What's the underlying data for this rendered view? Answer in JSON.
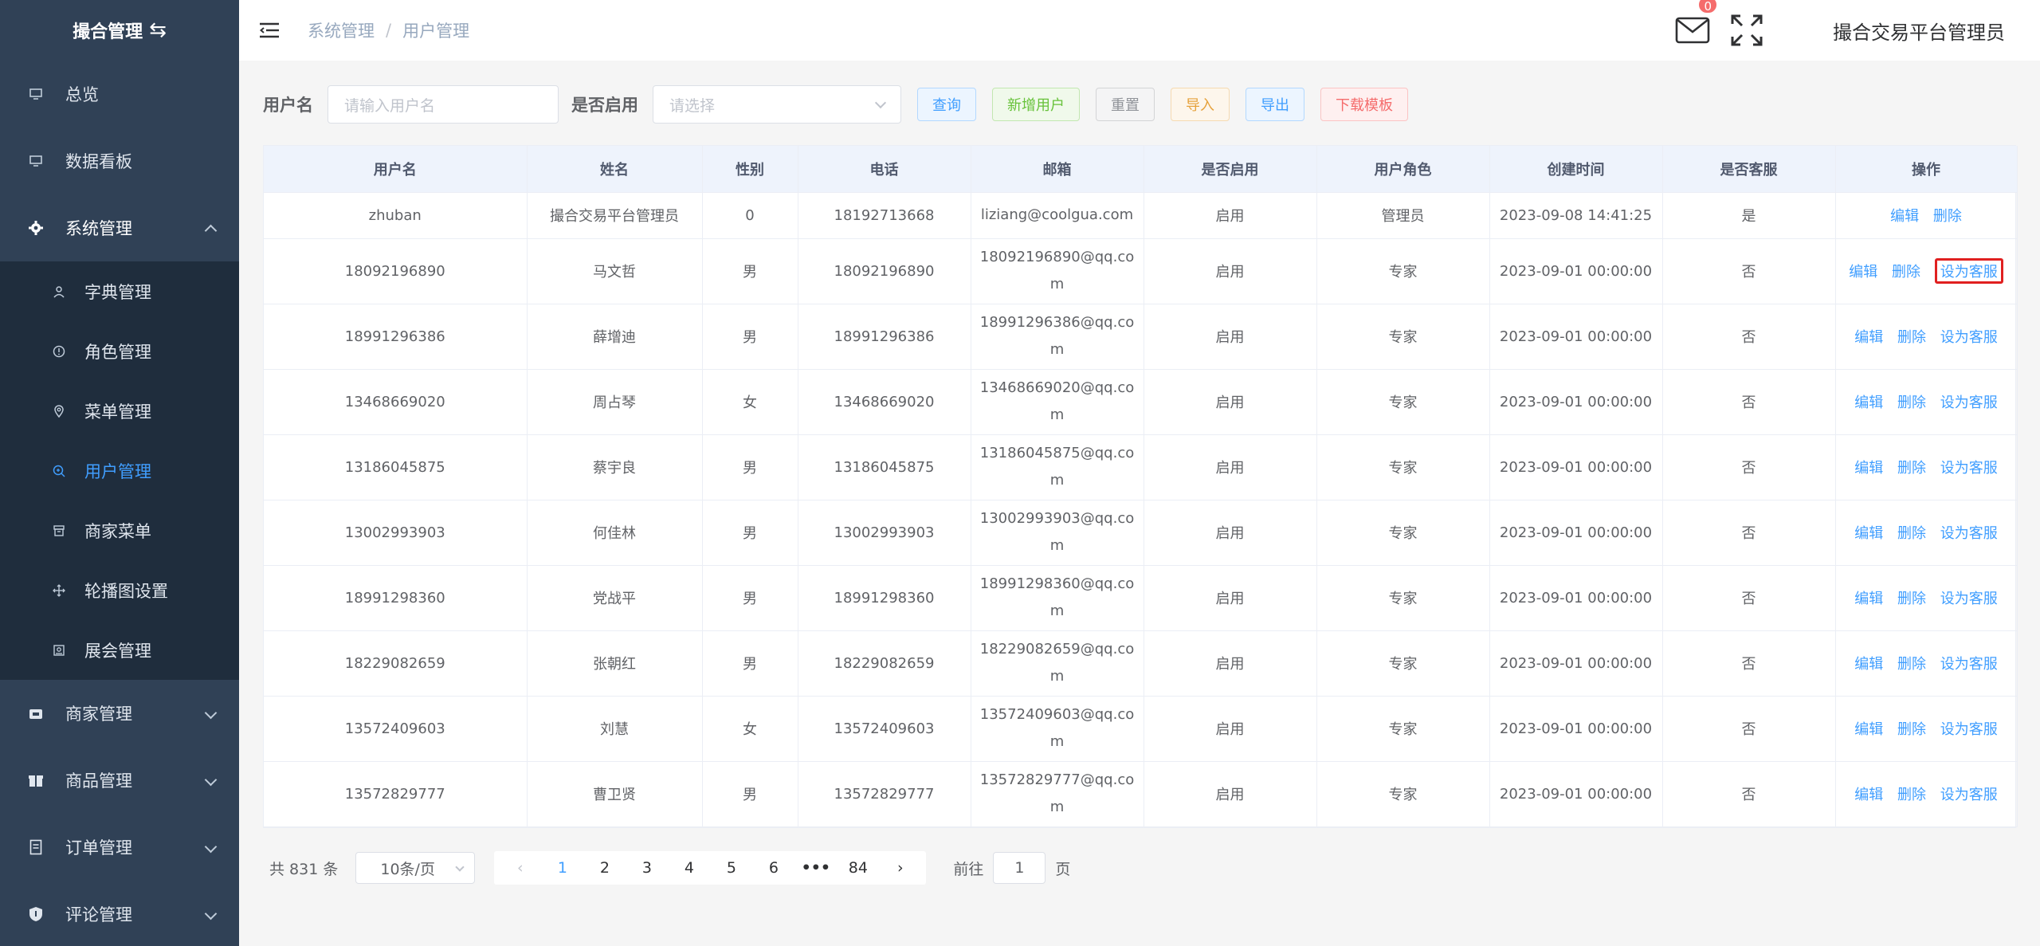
{
  "sidebar": {
    "logo_text": "撮合管理",
    "items": [
      {
        "label": "总览"
      },
      {
        "label": "数据看板"
      },
      {
        "label": "系统管理"
      },
      {
        "label": "商家管理"
      },
      {
        "label": "商品管理"
      },
      {
        "label": "订单管理"
      },
      {
        "label": "评论管理"
      }
    ],
    "system_sub": [
      {
        "label": "字典管理"
      },
      {
        "label": "角色管理"
      },
      {
        "label": "菜单管理"
      },
      {
        "label": "用户管理"
      },
      {
        "label": "商家菜单"
      },
      {
        "label": "轮播图设置"
      },
      {
        "label": "展会管理"
      }
    ]
  },
  "header": {
    "breadcrumb": [
      "系统管理",
      "用户管理"
    ],
    "breadcrumb_sep": "/",
    "mail_badge": "0",
    "username": "撮合交易平台管理员"
  },
  "search": {
    "username_label": "用户名",
    "username_placeholder": "请输入用户名",
    "enabled_label": "是否启用",
    "enabled_placeholder": "请选择",
    "buttons": {
      "query": "查询",
      "add": "新增用户",
      "reset": "重置",
      "import": "导入",
      "export": "导出",
      "template": "下载模板"
    }
  },
  "table": {
    "headers": [
      "用户名",
      "姓名",
      "性别",
      "电话",
      "邮箱",
      "是否启用",
      "用户角色",
      "创建时间",
      "是否客服",
      "操作"
    ],
    "op_labels": {
      "edit": "编辑",
      "delete": "删除",
      "set_cs": "设为客服"
    },
    "rows": [
      {
        "username": "zhuban",
        "name": "撮合交易平台管理员",
        "gender": "0",
        "phone": "18192713668",
        "email": "liziang@coolgua.com",
        "enabled": "启用",
        "role": "管理员",
        "created": "2023-09-08 14:41:25",
        "is_cs": "是"
      },
      {
        "username": "18092196890",
        "name": "马文哲",
        "gender": "男",
        "phone": "18092196890",
        "email": "18092196890@qq.com",
        "enabled": "启用",
        "role": "专家",
        "created": "2023-09-01 00:00:00",
        "is_cs": "否"
      },
      {
        "username": "18991296386",
        "name": "薛增迪",
        "gender": "男",
        "phone": "18991296386",
        "email": "18991296386@qq.com",
        "enabled": "启用",
        "role": "专家",
        "created": "2023-09-01 00:00:00",
        "is_cs": "否"
      },
      {
        "username": "13468669020",
        "name": "周占琴",
        "gender": "女",
        "phone": "13468669020",
        "email": "13468669020@qq.com",
        "enabled": "启用",
        "role": "专家",
        "created": "2023-09-01 00:00:00",
        "is_cs": "否"
      },
      {
        "username": "13186045875",
        "name": "蔡宇良",
        "gender": "男",
        "phone": "13186045875",
        "email": "13186045875@qq.com",
        "enabled": "启用",
        "role": "专家",
        "created": "2023-09-01 00:00:00",
        "is_cs": "否"
      },
      {
        "username": "13002993903",
        "name": "何佳林",
        "gender": "男",
        "phone": "13002993903",
        "email": "13002993903@qq.com",
        "enabled": "启用",
        "role": "专家",
        "created": "2023-09-01 00:00:00",
        "is_cs": "否"
      },
      {
        "username": "18991298360",
        "name": "党战平",
        "gender": "男",
        "phone": "18991298360",
        "email": "18991298360@qq.com",
        "enabled": "启用",
        "role": "专家",
        "created": "2023-09-01 00:00:00",
        "is_cs": "否"
      },
      {
        "username": "18229082659",
        "name": "张朝红",
        "gender": "男",
        "phone": "18229082659",
        "email": "18229082659@qq.com",
        "enabled": "启用",
        "role": "专家",
        "created": "2023-09-01 00:00:00",
        "is_cs": "否"
      },
      {
        "username": "13572409603",
        "name": "刘慧",
        "gender": "女",
        "phone": "13572409603",
        "email": "13572409603@qq.com",
        "enabled": "启用",
        "role": "专家",
        "created": "2023-09-01 00:00:00",
        "is_cs": "否"
      },
      {
        "username": "13572829777",
        "name": "曹卫贤",
        "gender": "男",
        "phone": "13572829777",
        "email": "13572829777@qq.com",
        "enabled": "启用",
        "role": "专家",
        "created": "2023-09-01 00:00:00",
        "is_cs": "否"
      }
    ]
  },
  "pagination": {
    "total_text": "共 831 条",
    "page_size": "10条/页",
    "pages": [
      "1",
      "2",
      "3",
      "4",
      "5",
      "6"
    ],
    "more": "•••",
    "last_page": "84",
    "goto_prefix": "前往",
    "goto_value": "1",
    "goto_suffix": "页"
  },
  "colors": {
    "sidebar_bg": "#304156",
    "submenu_bg": "#1f2d3d",
    "accent": "#409eff",
    "highlight_border": "#e02020"
  }
}
